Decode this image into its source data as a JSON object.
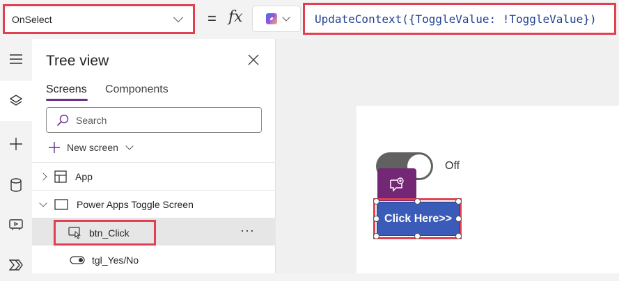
{
  "formula_bar": {
    "property": "OnSelect",
    "equals": "=",
    "fx": "fx",
    "formula": "UpdateContext({ToggleValue: !ToggleValue})"
  },
  "tree_view": {
    "title": "Tree view",
    "tabs": [
      {
        "label": "Screens",
        "active": true
      },
      {
        "label": "Components",
        "active": false
      }
    ],
    "search_placeholder": "Search",
    "new_screen_label": "New screen",
    "items": {
      "app": "App",
      "screen": "Power Apps Toggle Screen",
      "button": "btn_Click",
      "button_more": "···",
      "toggle": "tgl_Yes/No"
    }
  },
  "canvas": {
    "toggle_label": "Off",
    "button_label": "Click Here>>"
  },
  "colors": {
    "highlight": "#e04050",
    "accent": "#6b2f8e",
    "button": "#3a5bb8"
  },
  "icons": [
    "chevron-down-icon",
    "copilot-icon",
    "hamburger-icon",
    "layers-icon",
    "plus-icon",
    "database-icon",
    "media-icon",
    "power-automate-icon",
    "close-icon",
    "search-icon",
    "screen-icon",
    "button-icon",
    "toggle-icon",
    "comment-add-icon"
  ]
}
